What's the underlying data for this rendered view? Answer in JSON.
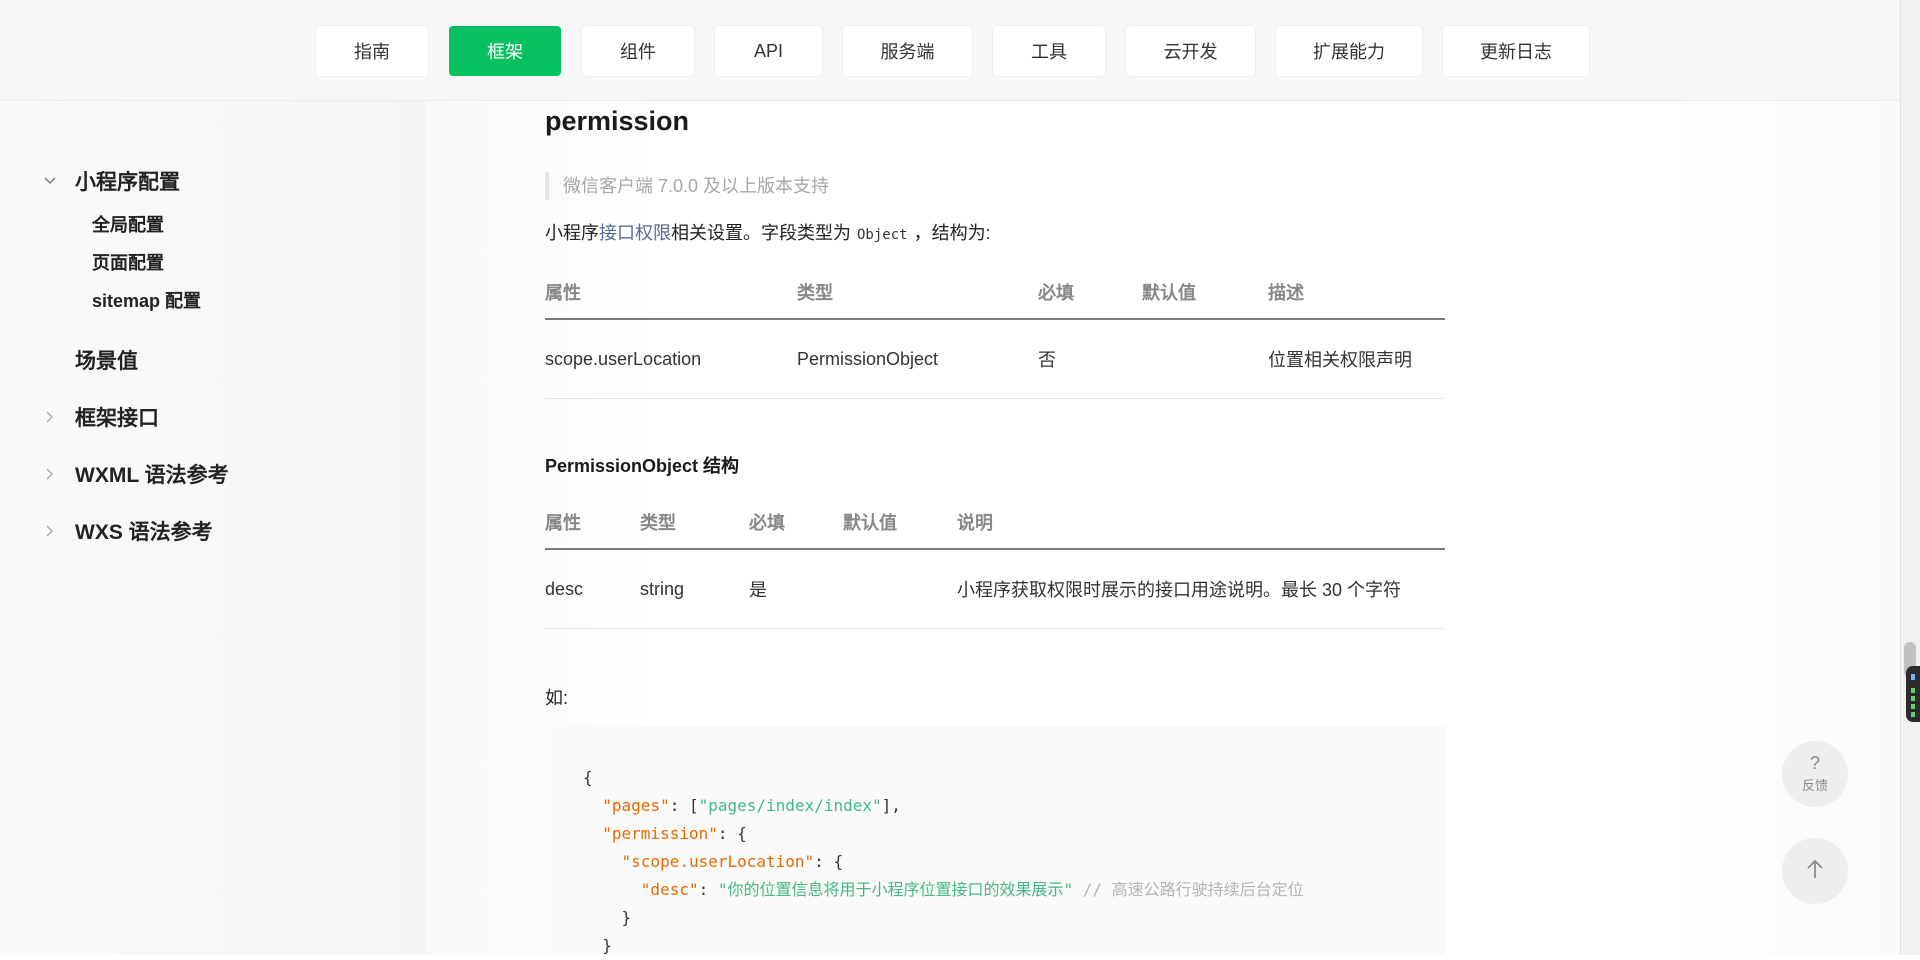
{
  "nav": {
    "items": [
      "指南",
      "框架",
      "组件",
      "API",
      "服务端",
      "工具",
      "云开发",
      "扩展能力",
      "更新日志"
    ],
    "active": "框架",
    "accent_color": "#07c160"
  },
  "sidebar": {
    "config_group": "小程序配置",
    "config_items": [
      "全局配置",
      "页面配置",
      "sitemap 配置"
    ],
    "scene": "场景值",
    "framework_api": "框架接口",
    "wxml": "WXML 语法参考",
    "wxs": "WXS 语法参考"
  },
  "section": {
    "title": "permission",
    "note": "微信客户端 7.0.0 及以上版本支持",
    "intro_prefix": "小程序",
    "intro_link": "接口权限",
    "intro_middle": "相关设置。字段类型为",
    "intro_code": "Object",
    "intro_suffix": "，结构为:"
  },
  "table1": {
    "headers": [
      "属性",
      "类型",
      "必填",
      "默认值",
      "描述"
    ],
    "row": [
      "scope.userLocation",
      "PermissionObject",
      "否",
      "",
      "位置相关权限声明"
    ]
  },
  "subsection": {
    "title": "PermissionObject 结构"
  },
  "table2": {
    "headers": [
      "属性",
      "类型",
      "必填",
      "默认值",
      "说明"
    ],
    "row": [
      "desc",
      "string",
      "是",
      "",
      "小程序获取权限时展示的接口用途说明。最长 30 个字符"
    ]
  },
  "example": {
    "label": "如:",
    "line1_brace": "{",
    "pages_key": "\"pages\"",
    "pages_value": "\"pages/index/index\"",
    "permission_key": "\"permission\"",
    "scope_key": "\"scope.userLocation\"",
    "desc_key": "\"desc\"",
    "desc_value": "\"你的位置信息将用于小程序位置接口的效果展示\"",
    "comment": "// 高速公路行驶持续后台定位"
  },
  "feedback": {
    "icon": "?",
    "label": "反馈"
  }
}
